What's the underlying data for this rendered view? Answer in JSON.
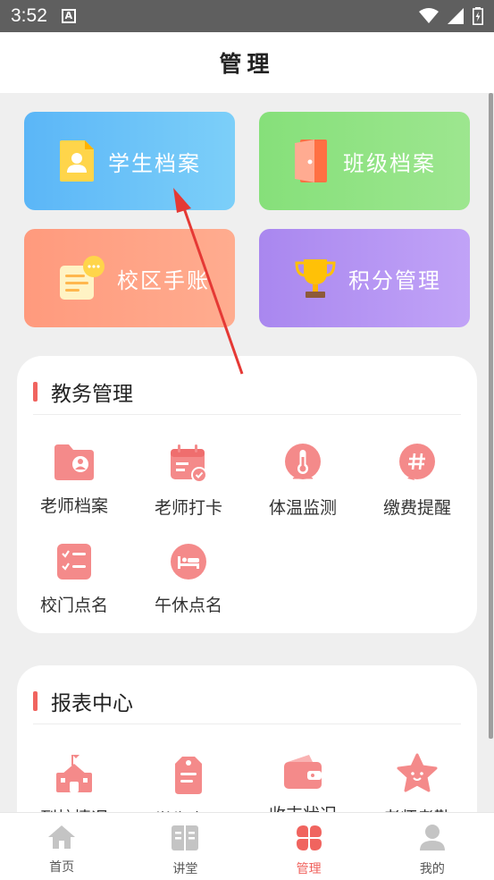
{
  "status_bar": {
    "time": "3:52",
    "notification_icon": "A"
  },
  "header": {
    "title": "管理"
  },
  "tiles": [
    {
      "label": "学生档案",
      "icon": "document-icon"
    },
    {
      "label": "班级档案",
      "icon": "door-icon"
    },
    {
      "label": "校区手账",
      "icon": "message-icon"
    },
    {
      "label": "积分管理",
      "icon": "trophy-icon"
    }
  ],
  "academic": {
    "title": "教务管理",
    "items": [
      {
        "label": "老师档案",
        "icon": "folder-user-icon"
      },
      {
        "label": "老师打卡",
        "icon": "calendar-check-icon"
      },
      {
        "label": "体温监测",
        "icon": "thermometer-icon"
      },
      {
        "label": "缴费提醒",
        "icon": "hash-icon"
      },
      {
        "label": "校门点名",
        "icon": "checklist-icon"
      },
      {
        "label": "午休点名",
        "icon": "bed-icon"
      }
    ]
  },
  "report": {
    "title": "报表中心",
    "items": [
      {
        "label": "到校情况",
        "icon": "school-icon"
      },
      {
        "label": "学生表现",
        "icon": "tag-icon"
      },
      {
        "label": "收支状况",
        "icon": "wallet-icon"
      },
      {
        "label": "老师考勤",
        "icon": "star-icon"
      }
    ]
  },
  "tabbar": {
    "items": [
      {
        "label": "首页",
        "icon": "home-icon"
      },
      {
        "label": "讲堂",
        "icon": "book-icon"
      },
      {
        "label": "管理",
        "icon": "clover-icon"
      },
      {
        "label": "我的",
        "icon": "user-icon"
      }
    ],
    "active_index": 2
  },
  "colors": {
    "accent": "#f0645f",
    "icon_pink": "#f37d7d",
    "icon_bg": "#fde3e2",
    "status_bar": "#5f5f5f",
    "arrow": "#e53935"
  }
}
